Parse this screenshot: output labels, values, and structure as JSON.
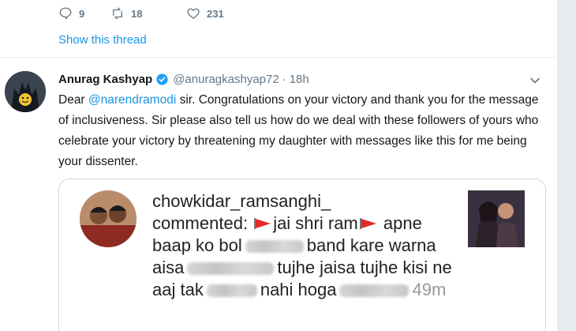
{
  "prev_tweet": {
    "reply_count": "9",
    "retweet_count": "18",
    "like_count": "231",
    "show_thread": "Show this thread"
  },
  "tweet": {
    "name": "Anurag Kashyap",
    "handle": "@anuragkashyap72",
    "separator": "·",
    "time": "18h",
    "text_1": "Dear ",
    "mention": "@narendramodi",
    "text_2": " sir. Congratulations on your victory and thank you for the message of inclusiveness. Sir please also tell us how do we deal with these followers of yours who celebrate your victory by threatening my daughter with messages like this for me being your dissenter."
  },
  "quoted": {
    "username": "chowkidar_ramsanghi_",
    "part_1": "commented:",
    "part_2": "jai shri ram",
    "part_3": "apne baap ko bol",
    "part_4": "band kare warna aisa",
    "part_5": "tujhe jaisa tujhe kisi ne aaj tak",
    "part_6": "nahi hoga",
    "time": "49m"
  },
  "colors": {
    "link": "#1b95e0",
    "muted": "#657786",
    "flag": "#e02a2a"
  }
}
